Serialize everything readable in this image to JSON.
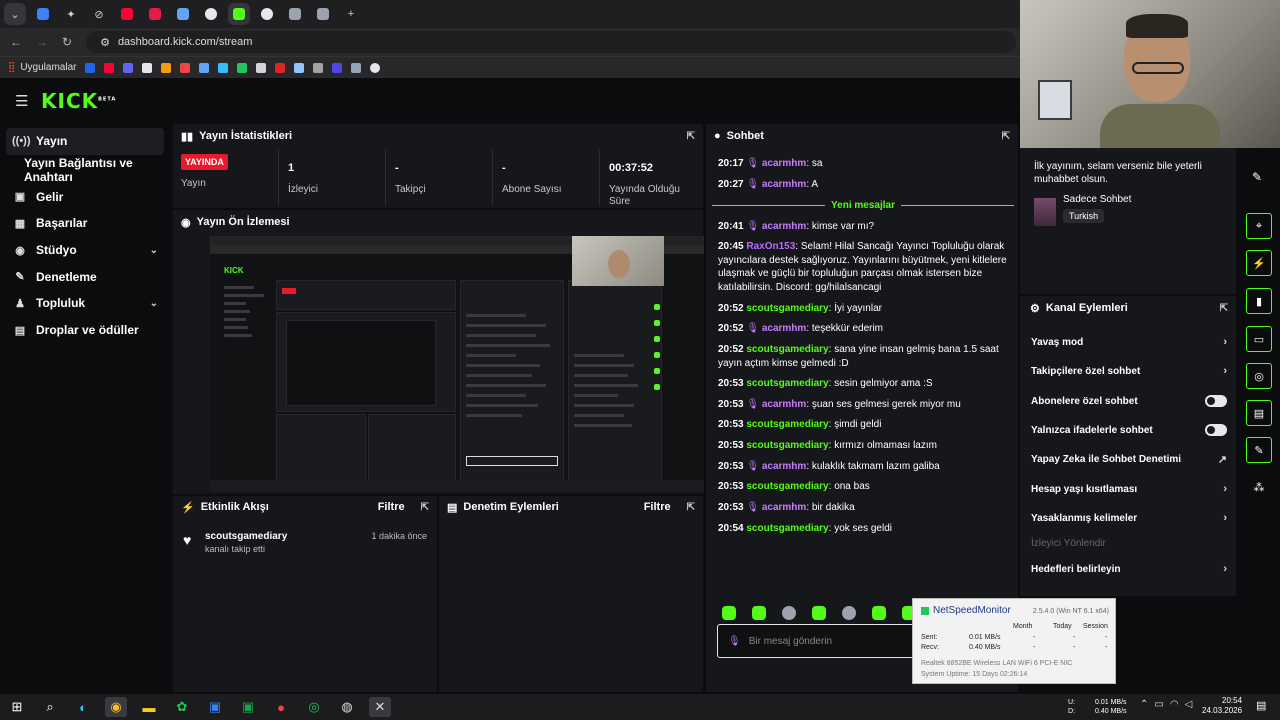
{
  "browser": {
    "url": "dashboard.kick.com/stream",
    "bookmarks_label": "Uygulamalar",
    "new_tab": "+"
  },
  "sidebar": {
    "items": [
      {
        "label": "Yayın",
        "icon": "broadcast-icon"
      },
      {
        "label": "Yayın Bağlantısı ve Anahtarı",
        "icon": ""
      },
      {
        "label": "Gelir",
        "icon": "dollar-icon"
      },
      {
        "label": "Başarılar",
        "icon": "trophy-icon"
      },
      {
        "label": "Stüdyo",
        "icon": "studio-icon"
      },
      {
        "label": "Denetleme",
        "icon": "wrench-icon"
      },
      {
        "label": "Topluluk",
        "icon": "people-icon"
      },
      {
        "label": "Droplar ve ödüller",
        "icon": "gift-icon"
      }
    ]
  },
  "stats": {
    "title": "Yayın İstatistikleri",
    "live_badge": "YAYINDA",
    "live_label": "Yayın",
    "viewers_value": "1",
    "viewers_label": "İzleyici",
    "followers_value": "-",
    "followers_label": "Takipçi",
    "subs_value": "-",
    "subs_label": "Abone Sayısı",
    "duration_value": "00:37:52",
    "duration_label": "Yayında Olduğu Süre"
  },
  "preview": {
    "title": "Yayın Ön İzlemesi"
  },
  "activity": {
    "title": "Etkinlik Akışı",
    "filter": "Filtre",
    "items": [
      {
        "user": "scoutsgamediary",
        "action": "kanalı takip etti",
        "time": "1 dakika önce"
      }
    ]
  },
  "moderation": {
    "title": "Denetim Eylemleri",
    "filter": "Filtre"
  },
  "chat": {
    "title": "Sohbet",
    "new_messages": "Yeni mesajlar",
    "input_placeholder": "Bir mesaj gönderin",
    "colors": {
      "acarmhm": "#c77dff",
      "scoutsgamediary": "#53fc18",
      "RaxOn153": "#b86bff"
    },
    "messages": [
      {
        "time": "20:17",
        "user": "acarmhm",
        "mic": true,
        "text": "sa"
      },
      {
        "time": "20:27",
        "user": "acarmhm",
        "mic": true,
        "text": "A"
      },
      {
        "time": "20:41",
        "user": "acarmhm",
        "mic": true,
        "text": "kimse var mı?"
      },
      {
        "time": "20:45",
        "user": "RaxOn153",
        "mic": false,
        "text": "Selam! Hilal Sancağı Yayıncı Topluluğu olarak yayıncılara destek sağlıyoruz. Yayınlarını büyütmek, yeni kitlelere ulaşmak ve güçlü bir topluluğun parçası olmak istersen bize katılabilirsin. Discord: gg/hilalsancagi"
      },
      {
        "time": "20:52",
        "user": "scoutsgamediary",
        "mic": false,
        "text": "İyi yayınlar"
      },
      {
        "time": "20:52",
        "user": "acarmhm",
        "mic": true,
        "text": "teşekkür ederim"
      },
      {
        "time": "20:52",
        "user": "scoutsgamediary",
        "mic": false,
        "text": "sana yine insan gelmiş bana 1.5 saat yayın açtım kimse gelmedi :D"
      },
      {
        "time": "20:53",
        "user": "scoutsgamediary",
        "mic": false,
        "text": "sesin gelmiyor ama :S"
      },
      {
        "time": "20:53",
        "user": "acarmhm",
        "mic": true,
        "text": "şuan ses gelmesi gerek miyor mu"
      },
      {
        "time": "20:53",
        "user": "scoutsgamediary",
        "mic": false,
        "text": "şimdi geldi"
      },
      {
        "time": "20:53",
        "user": "scoutsgamediary",
        "mic": false,
        "text": "kırmızı olmaması lazım"
      },
      {
        "time": "20:53",
        "user": "acarmhm",
        "mic": true,
        "text": "kulaklık takmam lazım galiba"
      },
      {
        "time": "20:53",
        "user": "scoutsgamediary",
        "mic": false,
        "text": "ona bas"
      },
      {
        "time": "20:53",
        "user": "acarmhm",
        "mic": true,
        "text": "bir dakika"
      },
      {
        "time": "20:54",
        "user": "scoutsgamediary",
        "mic": false,
        "text": "yok ses geldi"
      }
    ]
  },
  "stream_info": {
    "title": "İlk yayınım, selam verseniz bile yeterli muhabbet olsun.",
    "category": "Sadece Sohbet",
    "tag": "Turkish"
  },
  "channel_actions": {
    "title": "Kanal Eylemleri",
    "items": [
      {
        "label": "Yavaş mod",
        "control": "chevron"
      },
      {
        "label": "Takipçilere özel sohbet",
        "control": "chevron"
      },
      {
        "label": "Abonelere özel sohbet",
        "control": "toggle"
      },
      {
        "label": "Yalnızca ifadelerle sohbet",
        "control": "toggle"
      },
      {
        "label": "Yapay Zeka ile Sohbet Denetimi",
        "control": "external"
      },
      {
        "label": "Hesap yaşı kısıtlaması",
        "control": "chevron"
      },
      {
        "label": "Yasaklanmış kelimeler",
        "control": "chevron"
      },
      {
        "label": "İzleyici Yönlendir",
        "control": "disabled"
      },
      {
        "label": "Hedefleri belirleyin",
        "control": "chevron"
      }
    ]
  },
  "netspeed": {
    "title": "NetSpeedMonitor",
    "version": "2.5.4.0 (Win NT 6.1 x64)",
    "cols": [
      "Month",
      "Today",
      "Session"
    ],
    "sent_label": "Sent:",
    "sent_month": "0.01 MB/s",
    "recv_label": "Recv:",
    "recv_month": "0.40 MB/s",
    "dash": "-",
    "adapter": "Realtek 8852BE Wireless LAN WiFi 6 PCI-E NIC",
    "uptime": "System Uptime: 15 Days 02:26:14"
  },
  "taskbar": {
    "net_u": "U:",
    "net_d": "D:",
    "net_u_val": "0.01 MB/s",
    "net_d_val": "0.40 MB/s",
    "time": "20:54",
    "date": "24.03.2026"
  }
}
